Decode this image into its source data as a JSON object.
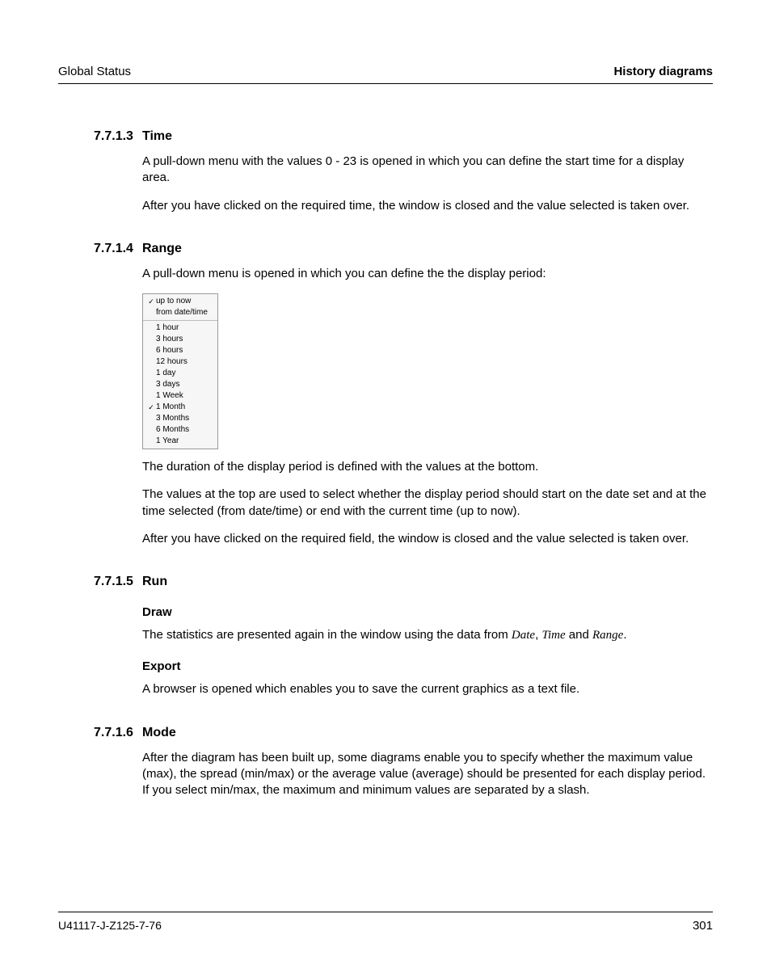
{
  "header": {
    "left": "Global Status",
    "right": "History diagrams"
  },
  "sections": {
    "s1": {
      "num": "7.7.1.3",
      "title": "Time",
      "p1": "A pull-down menu with the values 0 - 23 is opened in which you can define the start time for a display area.",
      "p2": "After you have clicked on the required time, the window is closed and the value selected is taken over."
    },
    "s2": {
      "num": "7.7.1.4",
      "title": "Range",
      "p1": "A pull-down menu is opened in which you can define the the display period:",
      "p2": "The duration of the display period is defined with the values at the bottom.",
      "p3": "The values at the top are used to select whether the display period should start on the date set and at the time selected (from date/time) or end with the current time (up to now).",
      "p4": "After you have clicked on the required field, the window is closed and the value selected is taken over."
    },
    "s3": {
      "num": "7.7.1.5",
      "title": "Run"
    },
    "s3draw": {
      "h": "Draw",
      "p_a": "The statistics are presented again in the window using the data from ",
      "i1": "Date",
      "c1": ", ",
      "i2": "Time",
      "c2": " and ",
      "i3": "Range",
      "c3": "."
    },
    "s3export": {
      "h": "Export",
      "p": "A browser is opened which enables you to save the current graphics as a text file."
    },
    "s4": {
      "num": "7.7.1.6",
      "title": "Mode",
      "p1": "After the diagram has been built up, some diagrams enable you to specify whether the maximum value (max), the spread (min/max) or the average value (average) should be presented for each display period. If you select min/max, the maximum and minimum values are separated by a slash."
    }
  },
  "dropdown": {
    "group1": [
      {
        "check": true,
        "label": "up to now"
      },
      {
        "check": false,
        "label": "from date/time"
      }
    ],
    "group2": [
      {
        "check": false,
        "label": "1 hour"
      },
      {
        "check": false,
        "label": "3 hours"
      },
      {
        "check": false,
        "label": "6 hours"
      },
      {
        "check": false,
        "label": "12 hours"
      },
      {
        "check": false,
        "label": "1 day"
      },
      {
        "check": false,
        "label": "3 days"
      },
      {
        "check": false,
        "label": "1 Week"
      },
      {
        "check": true,
        "label": "1 Month"
      },
      {
        "check": false,
        "label": "3 Months"
      },
      {
        "check": false,
        "label": "6 Months"
      },
      {
        "check": false,
        "label": "1 Year"
      }
    ]
  },
  "checkmark": "✓",
  "footer": {
    "left": "U41117-J-Z125-7-76",
    "right": "301"
  }
}
